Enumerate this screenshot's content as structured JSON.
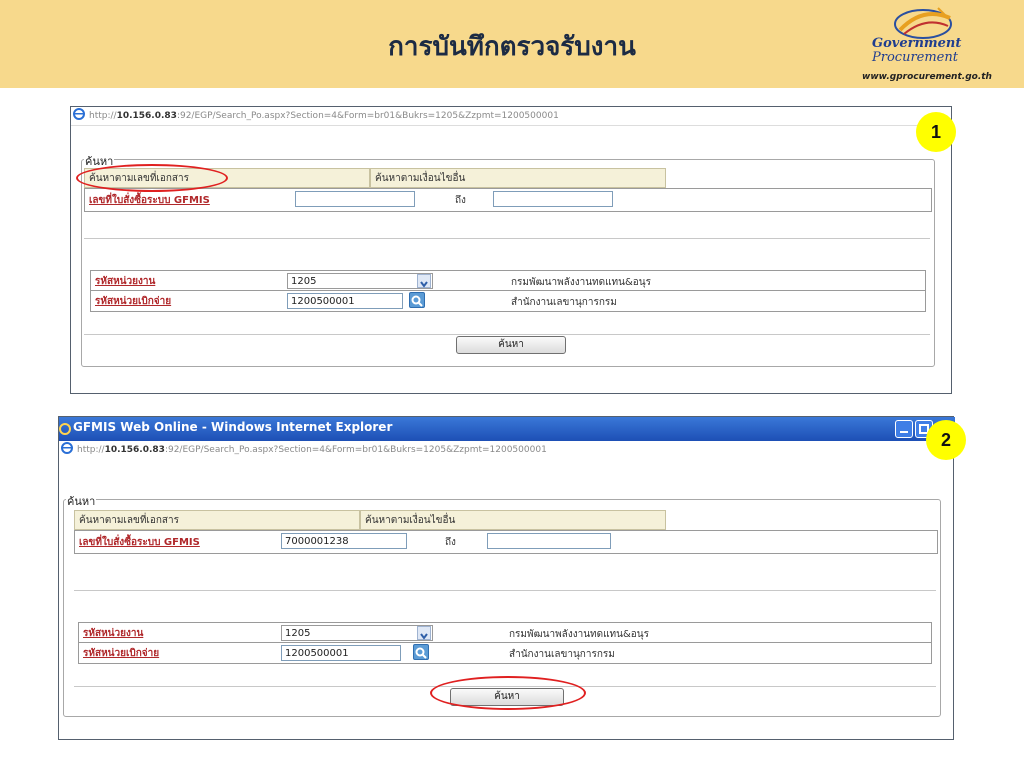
{
  "slide": {
    "title": "การบันทึกตรวจรับงาน"
  },
  "logo": {
    "line1": "Government",
    "line2": "Procurement",
    "url": "www.gprocurement.go.th"
  },
  "colors": {
    "header_bg": "#f7d98c",
    "badge": "#ffff00",
    "highlight_ring": "#e02020",
    "link_red": "#b0282b",
    "titlebar_blue": "#1d4fb5"
  },
  "screen1": {
    "badge": "1",
    "address_prefix": "http://",
    "address_host": "10.156.0.83",
    "address_rest": ":92/EGP/Search_Po.aspx?Section=4&Form=br01&Bukrs=1205&Zzpmt=1200500001",
    "legend": "ค้นหา",
    "tab_by_doc": "ค้นหาตามเลขที่เอกสาร",
    "tab_by_other": "ค้นหาตามเงื่อนไขอื่น",
    "gfmis_link": "เลขที่ใบสั่งซื้อระบบ GFMIS",
    "gfmis_from_value": "",
    "to_label": "ถึง",
    "gfmis_to_value": "",
    "agency_link": "รหัสหน่วยงาน",
    "agency_value": "1205",
    "agency_name": "กรมพัฒนาพลังงานทดแทน&อนุร",
    "disb_link": "รหัสหน่วยเบิกจ่าย",
    "disb_value": "1200500001",
    "disb_name": "สำนักงานเลขานุการกรม",
    "search_button": "ค้นหา"
  },
  "screen2": {
    "badge": "2",
    "window_title": "GFMIS Web Online - Windows Internet Explorer",
    "address_prefix": "http://",
    "address_host": "10.156.0.83",
    "address_rest": ":92/EGP/Search_Po.aspx?Section=4&Form=br01&Bukrs=1205&Zzpmt=1200500001",
    "legend": "ค้นหา",
    "tab_by_doc": "ค้นหาตามเลขที่เอกสาร",
    "tab_by_other": "ค้นหาตามเงื่อนไขอื่น",
    "gfmis_link": "เลขที่ใบสั่งซื้อระบบ GFMIS",
    "gfmis_from_value": "7000001238",
    "to_label": "ถึง",
    "gfmis_to_value": "",
    "agency_link": "รหัสหน่วยงาน",
    "agency_value": "1205",
    "agency_name": "กรมพัฒนาพลังงานทดแทน&อนุร",
    "disb_link": "รหัสหน่วยเบิกจ่าย",
    "disb_value": "1200500001",
    "disb_name": "สำนักงานเลขานุการกรม",
    "search_button": "ค้นหา"
  }
}
